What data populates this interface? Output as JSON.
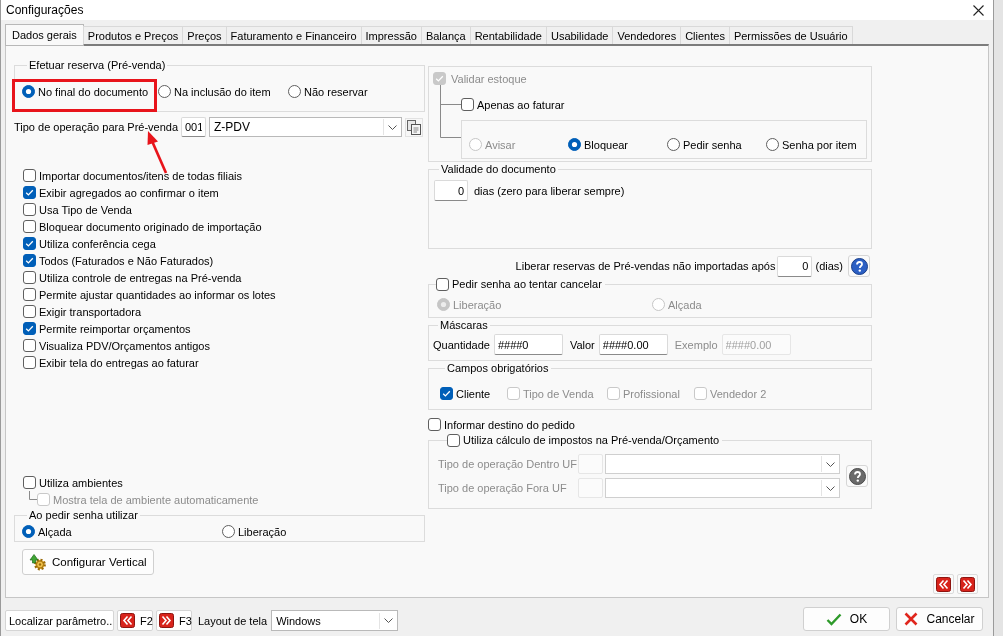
{
  "window": {
    "title": "Configurações"
  },
  "tabs": [
    {
      "label": "Dados gerais",
      "selected": true
    },
    {
      "label": "Produtos e Preços",
      "selected": false
    },
    {
      "label": "Preços",
      "selected": false
    },
    {
      "label": "Faturamento e Financeiro",
      "selected": false
    },
    {
      "label": "Impressão",
      "selected": false
    },
    {
      "label": "Balança",
      "selected": false
    },
    {
      "label": "Rentabilidade",
      "selected": false
    },
    {
      "label": "Usabilidade",
      "selected": false
    },
    {
      "label": "Vendedores",
      "selected": false
    },
    {
      "label": "Clientes",
      "selected": false
    },
    {
      "label": "Permissões de Usuário",
      "selected": false
    }
  ],
  "reservation": {
    "title": "Efetuar reserva (Pré-venda)",
    "options": [
      {
        "label": "No final do documento",
        "selected": true
      },
      {
        "label": "Na inclusão do item",
        "selected": false
      },
      {
        "label": "Não reservar",
        "selected": false
      }
    ]
  },
  "operation_type": {
    "label": "Tipo de operação para Pré-venda",
    "code": "001",
    "value": "Z-PDV"
  },
  "options": [
    {
      "label": "Importar documentos/itens de todas filiais",
      "checked": false
    },
    {
      "label": "Exibir agregados ao confirmar o item",
      "checked": true
    },
    {
      "label": "Usa Tipo de Venda",
      "checked": false
    },
    {
      "label": "Bloquear documento originado de importação",
      "checked": false
    },
    {
      "label": "Utiliza conferência cega",
      "checked": true
    },
    {
      "label": "Todos (Faturados e Não Faturados)",
      "checked": true
    },
    {
      "label": "Utiliza controle de entregas na Pré-venda",
      "checked": false
    },
    {
      "label": "Permite ajustar quantidades ao informar os lotes",
      "checked": false
    },
    {
      "label": "Exigir transportadora",
      "checked": false
    },
    {
      "label": "Permite reimportar orçamentos",
      "checked": true
    },
    {
      "label": "Visualiza PDV/Orçamentos antigos",
      "checked": false
    },
    {
      "label": "Exibir tela do entregas ao faturar",
      "checked": false
    }
  ],
  "environments": {
    "label": "Utiliza ambientes",
    "checked": false,
    "sub_option": {
      "label": "Mostra tela de ambiente automaticamente",
      "checked": false,
      "disabled": true
    }
  },
  "password_mode": {
    "title": "Ao pedir senha utilizar",
    "options": [
      {
        "label": "Alçada",
        "selected": true
      },
      {
        "label": "Liberação",
        "selected": false
      }
    ]
  },
  "configure_vertical_button": {
    "label": "Configurar Vertical"
  },
  "stock_validation": {
    "label": "Validar estoque",
    "checked": true,
    "disabled": true,
    "only_on_invoice": {
      "label": "Apenas ao faturar",
      "checked": false
    },
    "actions": [
      {
        "label": "Avisar",
        "selected": false,
        "disabled": true
      },
      {
        "label": "Bloquear",
        "selected": true,
        "disabled": false
      },
      {
        "label": "Pedir senha",
        "selected": false,
        "disabled": false
      },
      {
        "label": "Senha por item",
        "selected": false,
        "disabled": false
      }
    ]
  },
  "document_validity": {
    "title": "Validade do documento",
    "days": "0",
    "hint": "dias (zero para liberar sempre)"
  },
  "release_reservations": {
    "label": "Liberar reservas de Pré-vendas não importadas após",
    "days": "0",
    "unit": "(dias)"
  },
  "cancel_password": {
    "label": "Pedir senha ao tentar cancelar",
    "checked": false,
    "options": [
      {
        "label": "Liberação",
        "selected": true,
        "disabled": true
      },
      {
        "label": "Alçada",
        "selected": false,
        "disabled": true
      }
    ]
  },
  "masks": {
    "title": "Máscaras",
    "fields": [
      {
        "label": "Quantidade",
        "value": "####0",
        "disabled": false
      },
      {
        "label": "Valor",
        "value": "####0.00",
        "disabled": false
      },
      {
        "label": "Exemplo",
        "value": "####0.00",
        "disabled": true
      }
    ]
  },
  "required_fields": {
    "title": "Campos obrigatórios",
    "items": [
      {
        "label": "Cliente",
        "checked": true,
        "disabled": false
      },
      {
        "label": "Tipo de Venda",
        "checked": false,
        "disabled": true
      },
      {
        "label": "Profissional",
        "checked": false,
        "disabled": true
      },
      {
        "label": "Vendedor 2",
        "checked": false,
        "disabled": true
      }
    ]
  },
  "inform_destination": {
    "label": "Informar destino do pedido",
    "checked": false
  },
  "tax_calculation": {
    "label": "Utiliza cálculo de impostos na Pré-venda/Orçamento",
    "checked": false,
    "rows": [
      {
        "label": "Tipo de operação Dentro UF",
        "disabled": true
      },
      {
        "label": "Tipo de operação Fora UF",
        "disabled": true
      }
    ]
  },
  "footer": {
    "find_button": "Localizar parâmetro..",
    "previous_button": "F2",
    "next_button": "F3",
    "layout_label": "Layout de tela",
    "layout_value": "Windows",
    "ok_button": "OK",
    "cancel_button": "Cancelar"
  }
}
